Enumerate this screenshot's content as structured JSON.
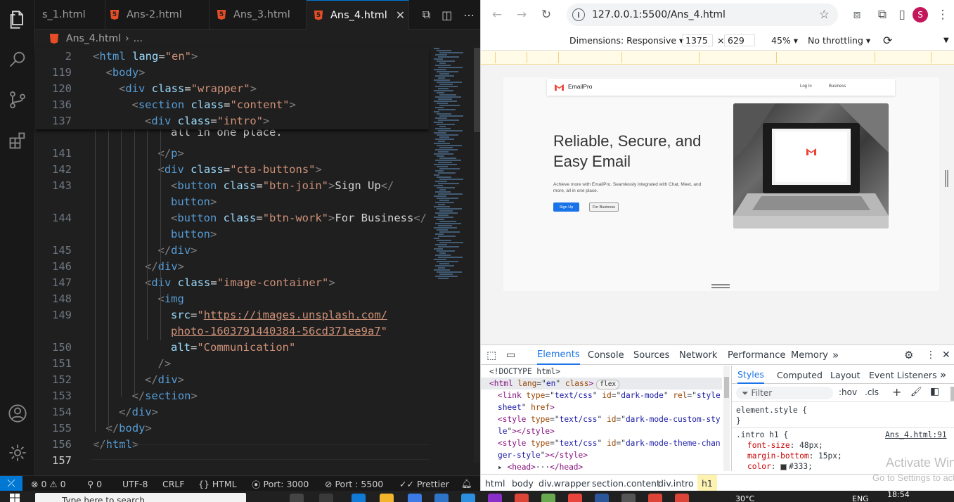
{
  "vscode": {
    "tabs": [
      {
        "label": "s_1.html",
        "active": false
      },
      {
        "label": "Ans-2.html",
        "active": false
      },
      {
        "label": "Ans_3.html",
        "active": false
      },
      {
        "label": "Ans_4.html",
        "active": true
      }
    ],
    "tab_close": "✕",
    "breadcrumb": {
      "file": "Ans_4.html",
      "sep": "›",
      "rest": "..."
    },
    "lines": [
      {
        "n": "2",
        "indent": 0,
        "parts": [
          [
            "t-punct",
            "<"
          ],
          [
            "t-tag",
            "html "
          ],
          [
            "t-attr",
            "lang"
          ],
          [
            "t-text",
            "="
          ],
          [
            "t-str",
            "\"en\""
          ],
          [
            "t-punct",
            ">"
          ]
        ]
      },
      {
        "n": "119",
        "indent": 1,
        "parts": [
          [
            "t-punct",
            "<"
          ],
          [
            "t-tag",
            "body"
          ],
          [
            "t-punct",
            ">"
          ]
        ]
      },
      {
        "n": "120",
        "indent": 2,
        "parts": [
          [
            "t-punct",
            "<"
          ],
          [
            "t-tag",
            "div "
          ],
          [
            "t-attr",
            "class"
          ],
          [
            "t-text",
            "="
          ],
          [
            "t-str",
            "\"wrapper\""
          ],
          [
            "t-punct",
            ">"
          ]
        ]
      },
      {
        "n": "136",
        "indent": 3,
        "parts": [
          [
            "t-punct",
            "<"
          ],
          [
            "t-tag",
            "section "
          ],
          [
            "t-attr",
            "class"
          ],
          [
            "t-text",
            "="
          ],
          [
            "t-str",
            "\"content\""
          ],
          [
            "t-punct",
            ">"
          ]
        ]
      },
      {
        "n": "137",
        "indent": 4,
        "parts": [
          [
            "t-punct",
            "<"
          ],
          [
            "t-tag",
            "div "
          ],
          [
            "t-attr",
            "class"
          ],
          [
            "t-text",
            "="
          ],
          [
            "t-str",
            "\"intro\""
          ],
          [
            "t-punct",
            ">"
          ]
        ]
      },
      {
        "n": "",
        "indent": 6,
        "parts": [
          [
            "t-text",
            "all in one place."
          ]
        ]
      },
      {
        "n": "141",
        "indent": 5,
        "parts": [
          [
            "t-punct",
            "</"
          ],
          [
            "t-tag",
            "p"
          ],
          [
            "t-punct",
            ">"
          ]
        ]
      },
      {
        "n": "142",
        "indent": 5,
        "parts": [
          [
            "t-punct",
            "<"
          ],
          [
            "t-tag",
            "div "
          ],
          [
            "t-attr",
            "class"
          ],
          [
            "t-text",
            "="
          ],
          [
            "t-str",
            "\"cta-buttons\""
          ],
          [
            "t-punct",
            ">"
          ]
        ]
      },
      {
        "n": "143",
        "indent": 6,
        "parts": [
          [
            "t-punct",
            "<"
          ],
          [
            "t-tag",
            "button "
          ],
          [
            "t-attr",
            "class"
          ],
          [
            "t-text",
            "="
          ],
          [
            "t-str",
            "\"btn-join\""
          ],
          [
            "t-punct",
            ">"
          ],
          [
            "t-text",
            "Sign Up"
          ],
          [
            "t-punct",
            "</"
          ]
        ]
      },
      {
        "n": "",
        "indent": 6,
        "parts": [
          [
            "t-tag",
            "button"
          ],
          [
            "t-punct",
            ">"
          ]
        ]
      },
      {
        "n": "144",
        "indent": 6,
        "parts": [
          [
            "t-punct",
            "<"
          ],
          [
            "t-tag",
            "button "
          ],
          [
            "t-attr",
            "class"
          ],
          [
            "t-text",
            "="
          ],
          [
            "t-str",
            "\"btn-work\""
          ],
          [
            "t-punct",
            ">"
          ],
          [
            "t-text",
            "For Business"
          ],
          [
            "t-punct",
            "</"
          ]
        ]
      },
      {
        "n": "",
        "indent": 6,
        "parts": [
          [
            "t-tag",
            "button"
          ],
          [
            "t-punct",
            ">"
          ]
        ]
      },
      {
        "n": "145",
        "indent": 5,
        "parts": [
          [
            "t-punct",
            "</"
          ],
          [
            "t-tag",
            "div"
          ],
          [
            "t-punct",
            ">"
          ]
        ]
      },
      {
        "n": "146",
        "indent": 4,
        "parts": [
          [
            "t-punct",
            "</"
          ],
          [
            "t-tag",
            "div"
          ],
          [
            "t-punct",
            ">"
          ]
        ]
      },
      {
        "n": "147",
        "indent": 4,
        "parts": [
          [
            "t-punct",
            "<"
          ],
          [
            "t-tag",
            "div "
          ],
          [
            "t-attr",
            "class"
          ],
          [
            "t-text",
            "="
          ],
          [
            "t-str",
            "\"image-container\""
          ],
          [
            "t-punct",
            ">"
          ]
        ]
      },
      {
        "n": "148",
        "indent": 5,
        "parts": [
          [
            "t-punct",
            "<"
          ],
          [
            "t-tag",
            "img"
          ]
        ]
      },
      {
        "n": "149",
        "indent": 6,
        "parts": [
          [
            "t-attr",
            "src"
          ],
          [
            "t-text",
            "="
          ],
          [
            "t-str",
            "\""
          ],
          [
            "t-link",
            "https://images.unsplash.com/"
          ]
        ]
      },
      {
        "n": "",
        "indent": 6,
        "parts": [
          [
            "t-link",
            "photo-1603791440384-56cd371ee9a7"
          ],
          [
            "t-str",
            "\""
          ]
        ]
      },
      {
        "n": "150",
        "indent": 6,
        "parts": [
          [
            "t-attr",
            "alt"
          ],
          [
            "t-text",
            "="
          ],
          [
            "t-str",
            "\"Communication\""
          ]
        ]
      },
      {
        "n": "151",
        "indent": 5,
        "parts": [
          [
            "t-punct",
            "/>"
          ]
        ]
      },
      {
        "n": "152",
        "indent": 4,
        "parts": [
          [
            "t-punct",
            "</"
          ],
          [
            "t-tag",
            "div"
          ],
          [
            "t-punct",
            ">"
          ]
        ]
      },
      {
        "n": "153",
        "indent": 3,
        "parts": [
          [
            "t-punct",
            "</"
          ],
          [
            "t-tag",
            "section"
          ],
          [
            "t-punct",
            ">"
          ]
        ]
      },
      {
        "n": "154",
        "indent": 2,
        "parts": [
          [
            "t-punct",
            "</"
          ],
          [
            "t-tag",
            "div"
          ],
          [
            "t-punct",
            ">"
          ]
        ]
      },
      {
        "n": "155",
        "indent": 1,
        "parts": [
          [
            "t-punct",
            "</"
          ],
          [
            "t-tag",
            "body"
          ],
          [
            "t-punct",
            ">"
          ]
        ]
      },
      {
        "n": "156",
        "indent": 0,
        "parts": [
          [
            "t-punct",
            "</"
          ],
          [
            "t-tag",
            "html"
          ],
          [
            "t-punct",
            ">"
          ]
        ]
      },
      {
        "n": "157",
        "indent": 0,
        "parts": [],
        "current": true
      }
    ],
    "status": {
      "errors": "0",
      "warnings": "0",
      "ports_fwd": "0",
      "encoding": "UTF-8",
      "eol": "CRLF",
      "language": "HTML",
      "port_a": "Port: 3000",
      "port_b": "Port : 5500",
      "formatter": "Prettier"
    }
  },
  "browser": {
    "url": "127.0.0.1:5500/Ans_4.html",
    "avatar_letter": "S",
    "devtools_bar": {
      "dimensions_label": "Dimensions: Responsive ▾",
      "width": "1375",
      "times": "×",
      "height": "629",
      "zoom": "45% ▾",
      "throttling": "No throttling ▾"
    },
    "page": {
      "brand": "EmailPro",
      "nav_links": [
        "Log In",
        "Business"
      ],
      "hero_title": "Reliable, Secure, and Easy Email",
      "hero_sub": "Achieve more with EmailPro. Seamlessly integrated with Chat, Meet, and more, all in one place.",
      "btn_join": "Sign Up",
      "btn_work": "For Business",
      "accent": "#1a73e8"
    },
    "devtools": {
      "tabs": [
        "Elements",
        "Console",
        "Sources",
        "Network",
        "Performance",
        "Memory"
      ],
      "more": "»",
      "dom_lines": [
        [
          [
            "d-txt",
            "<!DOCTYPE html>"
          ]
        ],
        [
          [
            "d-tag",
            "<html "
          ],
          [
            "d-attr",
            "lang"
          ],
          [
            "d-txt",
            "=\""
          ],
          [
            "d-val",
            "en"
          ],
          [
            "d-txt",
            "\" "
          ],
          [
            "d-attr",
            "class"
          ],
          [
            "d-tag",
            ">"
          ]
        ],
        [
          [
            "d-tag",
            "<link "
          ],
          [
            "d-attr",
            "type"
          ],
          [
            "d-txt",
            "=\""
          ],
          [
            "d-val",
            "text/css"
          ],
          [
            "d-txt",
            "\" "
          ],
          [
            "d-attr",
            "id"
          ],
          [
            "d-txt",
            "=\""
          ],
          [
            "d-val",
            "dark-mode"
          ],
          [
            "d-txt",
            "\" "
          ],
          [
            "d-attr",
            "rel"
          ],
          [
            "d-txt",
            "=\""
          ],
          [
            "d-val",
            "style"
          ]
        ],
        [
          [
            "d-val",
            "sheet"
          ],
          [
            "d-txt",
            "\" "
          ],
          [
            "d-attr",
            "href"
          ],
          [
            "d-tag",
            ">"
          ]
        ],
        [
          [
            "d-tag",
            "<style "
          ],
          [
            "d-attr",
            "type"
          ],
          [
            "d-txt",
            "=\""
          ],
          [
            "d-val",
            "text/css"
          ],
          [
            "d-txt",
            "\" "
          ],
          [
            "d-attr",
            "id"
          ],
          [
            "d-txt",
            "=\""
          ],
          [
            "d-val",
            "dark-mode-custom-sty"
          ]
        ],
        [
          [
            "d-val",
            "le"
          ],
          [
            "d-txt",
            "\""
          ],
          [
            "d-tag",
            "></style>"
          ]
        ],
        [
          [
            "d-tag",
            "<style "
          ],
          [
            "d-attr",
            "type"
          ],
          [
            "d-txt",
            "=\""
          ],
          [
            "d-val",
            "text/css"
          ],
          [
            "d-txt",
            "\" "
          ],
          [
            "d-attr",
            "id"
          ],
          [
            "d-txt",
            "=\""
          ],
          [
            "d-val",
            "dark-mode-theme-chan"
          ]
        ],
        [
          [
            "d-val",
            "ger-style"
          ],
          [
            "d-txt",
            "\""
          ],
          [
            "d-tag",
            "></style>"
          ]
        ],
        [
          [
            "d-txt",
            "▸ "
          ],
          [
            "d-tag",
            "<head>"
          ],
          [
            "d-txt",
            "···"
          ],
          [
            "d-tag",
            "</head>"
          ]
        ]
      ],
      "flex_badge": "flex",
      "styles_tabs": [
        "Styles",
        "Computed",
        "Layout",
        "Event Listeners"
      ],
      "filter_placeholder": "Filter",
      "filter_tools": [
        ":hov",
        ".cls",
        "+"
      ],
      "element_style": "element.style {",
      "close_brace": "}",
      "rule_selector": ".intro h1 {",
      "rule_source": "Ans_4.html:91",
      "props": [
        {
          "name": "font-size",
          "value": "48px;"
        },
        {
          "name": "margin-bottom",
          "value": "15px;"
        },
        {
          "name": "color",
          "value": "#333;"
        }
      ],
      "watermark_title": "Activate Windows",
      "watermark_sub": "Go to Settings to activate Windows.",
      "breadcrumbs": [
        "html",
        "body",
        "div.wrapper",
        "section.content",
        "div.intro",
        "h1"
      ]
    }
  },
  "taskbar": {
    "search_placeholder": "Type here to search",
    "temperature": "30°C",
    "lang": "ENG",
    "time": "18:54"
  }
}
